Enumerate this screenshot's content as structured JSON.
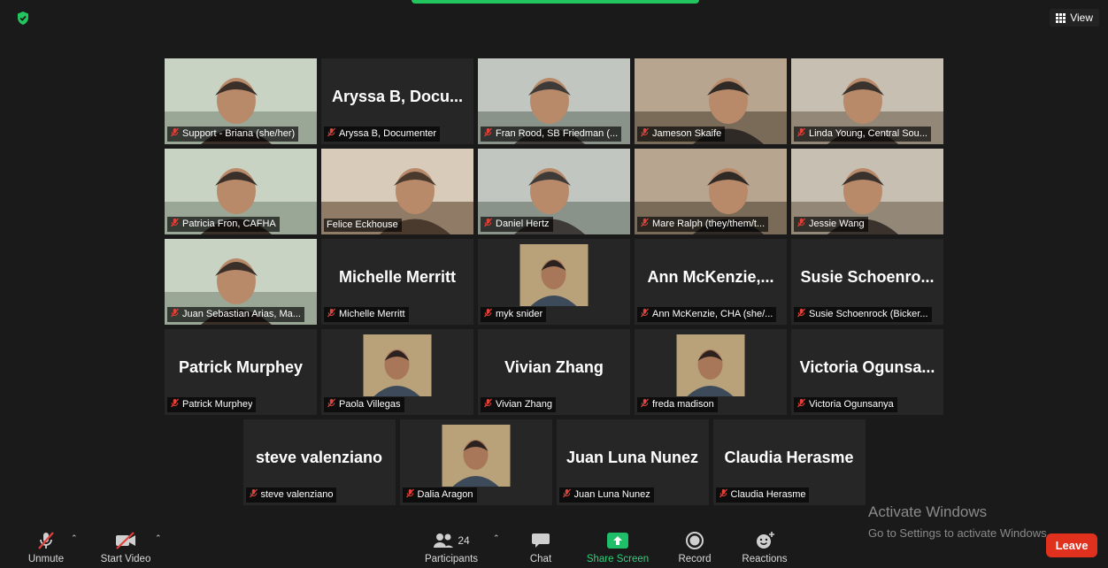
{
  "window": {
    "view_label": "View"
  },
  "colors": {
    "active_speaker": "#8fd14f",
    "leave": "#e0301e",
    "share_screen": "#2fd07a",
    "muted_icon": "#e0423a"
  },
  "gallery": {
    "rows": [
      [
        {
          "label": "Support - Briana (she/her)",
          "type": "video",
          "active": true
        },
        {
          "label": "Aryssa B, Documenter",
          "type": "name",
          "display": "Aryssa B, Docu..."
        },
        {
          "label": "Fran Rood, SB Friedman (...",
          "type": "video"
        },
        {
          "label": "Jameson Skaife",
          "type": "video"
        },
        {
          "label": "Linda Young, Central Sou...",
          "type": "video"
        }
      ],
      [
        {
          "label": "Patricia Fron, CAFHA",
          "type": "video"
        },
        {
          "label": "Felice Eckhouse",
          "type": "video",
          "unmuted": true
        },
        {
          "label": "Daniel Hertz",
          "type": "video"
        },
        {
          "label": "Mare Ralph (they/them/t...",
          "type": "video"
        },
        {
          "label": "Jessie Wang",
          "type": "video"
        }
      ],
      [
        {
          "label": "Juan Sebastian Arias, Ma...",
          "type": "video"
        },
        {
          "label": "Michelle Merritt",
          "type": "name",
          "display": "Michelle Merritt"
        },
        {
          "label": "myk snider",
          "type": "avatar"
        },
        {
          "label": "Ann McKenzie, CHA (she/...",
          "type": "name",
          "display": "Ann McKenzie,..."
        },
        {
          "label": "Susie Schoenrock (Bicker...",
          "type": "name",
          "display": "Susie Schoenro..."
        }
      ],
      [
        {
          "label": "Patrick Murphey",
          "type": "name",
          "display": "Patrick Murphey"
        },
        {
          "label": "Paola Villegas",
          "type": "avatar"
        },
        {
          "label": "Vivian Zhang",
          "type": "name",
          "display": "Vivian Zhang"
        },
        {
          "label": "freda madison",
          "type": "avatar"
        },
        {
          "label": "Victoria Ogunsanya",
          "type": "name",
          "display": "Victoria Ogunsa..."
        }
      ],
      [
        {
          "label": "steve valenziano",
          "type": "name",
          "display": "steve valenziano"
        },
        {
          "label": "Dalia Aragon",
          "type": "avatar"
        },
        {
          "label": "Juan Luna Nunez",
          "type": "name",
          "display": "Juan Luna Nunez"
        },
        {
          "label": "Claudia Herasme",
          "type": "name",
          "display": "Claudia Herasme"
        }
      ]
    ]
  },
  "watermark": {
    "line1": "Activate Windows",
    "line2": "Go to Settings to activate Windows."
  },
  "toolbar": {
    "unmute": "Unmute",
    "start_video": "Start Video",
    "participants": "Participants",
    "participants_count": "24",
    "chat": "Chat",
    "share_screen": "Share Screen",
    "record": "Record",
    "reactions": "Reactions",
    "leave": "Leave"
  }
}
